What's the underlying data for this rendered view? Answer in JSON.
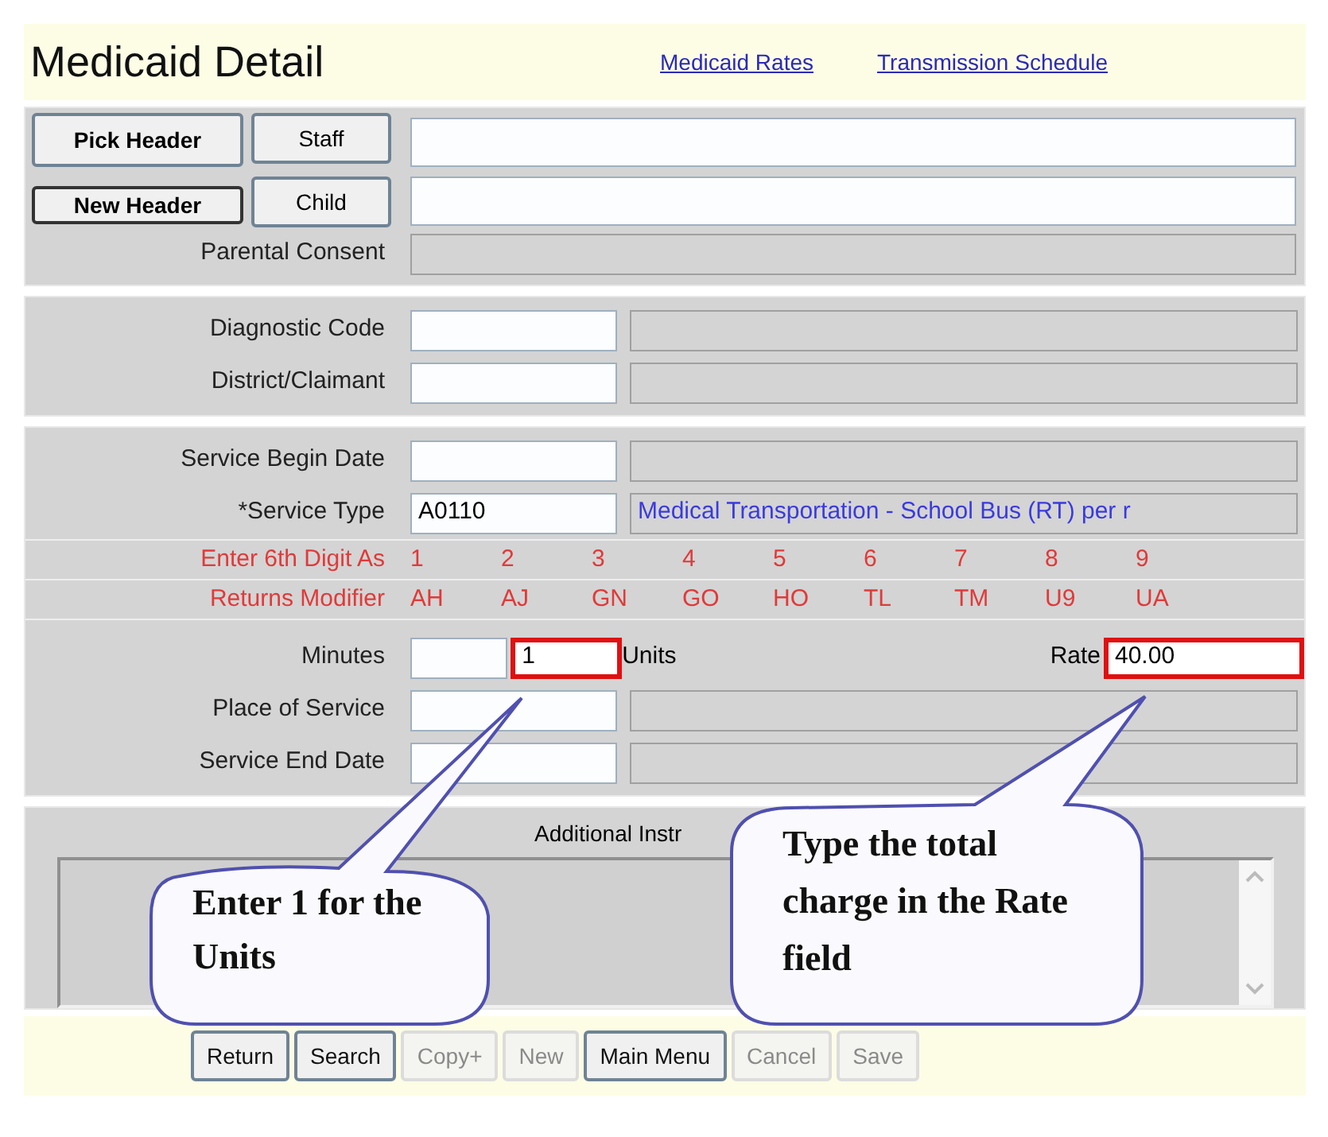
{
  "header": {
    "title": "Medicaid Detail",
    "links": [
      "Medicaid Rates",
      "Transmission Schedule"
    ]
  },
  "header_buttons": [
    {
      "label": "Pick Header"
    },
    {
      "label": "New Header"
    }
  ],
  "person_rows": [
    {
      "button": "Staff",
      "value": ""
    },
    {
      "button": "Child",
      "value": ""
    }
  ],
  "parental_consent": {
    "label": "Parental Consent"
  },
  "codes": [
    {
      "label": "Diagnostic Code"
    },
    {
      "label": "District/Claimant"
    }
  ],
  "service_begin": {
    "label": "Service Begin Date"
  },
  "service_type": {
    "label": "*Service Type",
    "value": "A0110",
    "description": "Medical Transportation - School Bus (RT) per r"
  },
  "modifier_rows": [
    {
      "label": "Enter 6th Digit As",
      "values": [
        "1",
        "2",
        "3",
        "4",
        "5",
        "6",
        "7",
        "8",
        "9"
      ]
    },
    {
      "label": "Returns Modifier",
      "values": [
        "AH",
        "AJ",
        "GN",
        "GO",
        "HO",
        "TL",
        "TM",
        "U9",
        "UA"
      ]
    }
  ],
  "minutes": {
    "label": "Minutes",
    "units_value": "1",
    "units_highlighted": true,
    "units_label": "Units",
    "rate_label": "Rate",
    "rate_value": "40.00",
    "rate_highlighted": true
  },
  "place_of_service": {
    "label": "Place of Service"
  },
  "service_end": {
    "label": "Service End Date"
  },
  "additional": {
    "label": "Additional Instr"
  },
  "callouts": [
    {
      "text": "Enter 1 for the Units"
    },
    {
      "text": "Type the total charge in the Rate field"
    }
  ],
  "footer_buttons": [
    {
      "label": "Return",
      "disabled": false
    },
    {
      "label": "Search",
      "disabled": false
    },
    {
      "label": "Copy+",
      "disabled": true
    },
    {
      "label": "New",
      "disabled": true
    },
    {
      "label": "Main Menu",
      "disabled": false
    },
    {
      "label": "Cancel",
      "disabled": true
    },
    {
      "label": "Save",
      "disabled": true
    }
  ]
}
